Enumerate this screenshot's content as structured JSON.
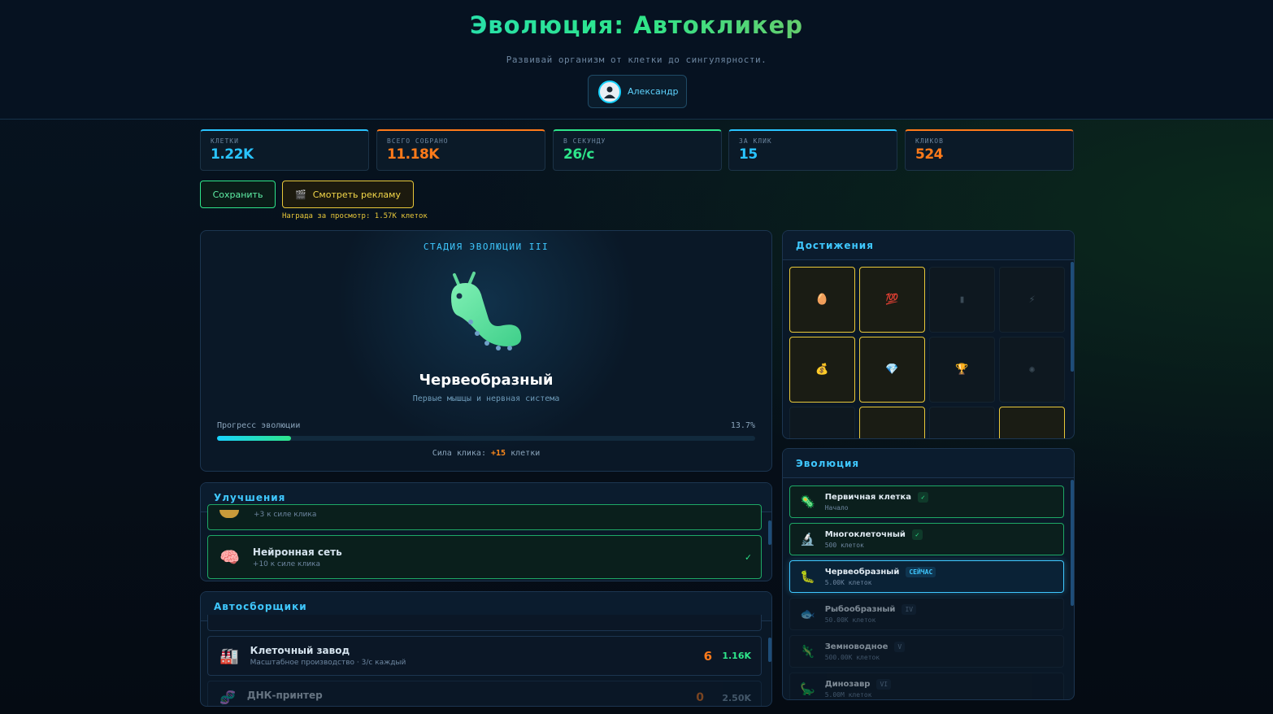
{
  "header": {
    "title": "Эволюция: Автокликер",
    "subtitle": "Развивай организм от клетки до сингулярности.",
    "user_name": "Александр"
  },
  "stats": [
    {
      "label": "КЛЕТКИ",
      "value": "1.22K",
      "color": "#29c4ff"
    },
    {
      "label": "ВСЕГО СОБРАНО",
      "value": "11.18K",
      "color": "#ff7a1a"
    },
    {
      "label": "В СЕКУНДУ",
      "value": "26/с",
      "color": "#2ee58a"
    },
    {
      "label": "ЗА КЛИК",
      "value": "15",
      "color": "#29c4ff"
    },
    {
      "label": "КЛИКОВ",
      "value": "524",
      "color": "#ff7a1a"
    }
  ],
  "actions": {
    "save_label": "Сохранить",
    "ad_label": "Смотреть рекламу",
    "ad_reward": "Награда за просмотр: 1.57K клеток"
  },
  "stage": {
    "label": "СТАДИЯ ЭВОЛЮЦИИ III",
    "name": "Червеобразный",
    "description": "Первые мышцы и нервная система",
    "progress_label": "Прогресс эволюции",
    "progress_text": "13.7%",
    "progress_fraction": 0.137,
    "click_power_prefix": "Сила клика:",
    "click_power_value": "+15",
    "click_power_suffix": "клетки"
  },
  "upgrades": {
    "title": "Улучшения",
    "items": [
      {
        "name": "",
        "desc": "+3 к силе клика",
        "icon": "cookie-icon"
      },
      {
        "name": "Нейронная сеть",
        "desc": "+10 к силе клика",
        "icon": "brain-icon",
        "check": "✓"
      }
    ]
  },
  "auto": {
    "title": "Автосборщики",
    "items": [
      {
        "name": "Клеточный завод",
        "desc": "Масштабное производство · 3/с каждый",
        "count": "6",
        "cost": "1.16K",
        "icon": "factory-icon"
      },
      {
        "name": "ДНК-принтер",
        "desc": "",
        "count": "0",
        "cost": "2.50K",
        "icon": "dna-icon"
      }
    ]
  },
  "achievements": {
    "title": "Достижения",
    "items": [
      {
        "icon": "egg-icon",
        "glyph": "🥚",
        "unlocked": true
      },
      {
        "icon": "hundred-icon",
        "glyph": "💯",
        "unlocked": true
      },
      {
        "icon": "book-icon",
        "glyph": "▮",
        "unlocked": false
      },
      {
        "icon": "lightning-icon",
        "glyph": "⚡",
        "unlocked": false
      },
      {
        "icon": "money-bag-icon",
        "glyph": "💰",
        "unlocked": true
      },
      {
        "icon": "gem-icon",
        "glyph": "💎",
        "unlocked": true
      },
      {
        "icon": "trophy-icon",
        "glyph": "🏆",
        "unlocked": false
      },
      {
        "icon": "virus-icon",
        "glyph": "✺",
        "unlocked": false
      }
    ]
  },
  "evolution": {
    "title": "Эволюция",
    "items": [
      {
        "name": "Первичная клетка",
        "cost": "Начало",
        "badge": "✓",
        "state": "done",
        "icon": "microbe-icon"
      },
      {
        "name": "Многоклеточный",
        "cost": "500 клеток",
        "badge": "✓",
        "state": "done",
        "icon": "microscope-icon"
      },
      {
        "name": "Червеобразный",
        "cost": "5.00K клеток",
        "badge": "СЕЙЧАС",
        "state": "cur",
        "icon": "worm-icon"
      },
      {
        "name": "Рыбообразный",
        "cost": "50.00K клеток",
        "badge": "IV",
        "state": "lock",
        "icon": "fish-icon"
      },
      {
        "name": "Земноводное",
        "cost": "500.00K клеток",
        "badge": "V",
        "state": "lock",
        "icon": "lizard-icon"
      },
      {
        "name": "Динозавр",
        "cost": "5.00M клеток",
        "badge": "VI",
        "state": "lock",
        "icon": "dinosaur-icon"
      }
    ]
  }
}
